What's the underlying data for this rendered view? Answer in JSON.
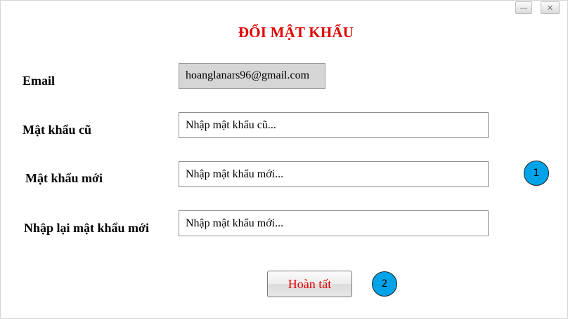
{
  "window": {
    "minimize_glyph": "—",
    "close_glyph": "✕"
  },
  "title": "ĐỔI MẬT KHẨU",
  "form": {
    "email_label": "Email",
    "email_value": "hoanglanars96@gmail.com",
    "old_password_label": "Mật khẩu cũ",
    "old_password_placeholder": "Nhập mật khẩu cũ...",
    "new_password_label": "Mật khẩu mới",
    "new_password_placeholder": "Nhập mật khẩu mới...",
    "confirm_password_label": "Nhập lại mật khẩu mới",
    "confirm_password_placeholder": "Nhập mật khẩu mới...",
    "submit_label": "Hoàn tất"
  },
  "annotations": {
    "marker_1": "1",
    "marker_2": "2",
    "color": "#00a2e8"
  },
  "colors": {
    "title": "#e00000",
    "submit_text": "#e00000"
  }
}
